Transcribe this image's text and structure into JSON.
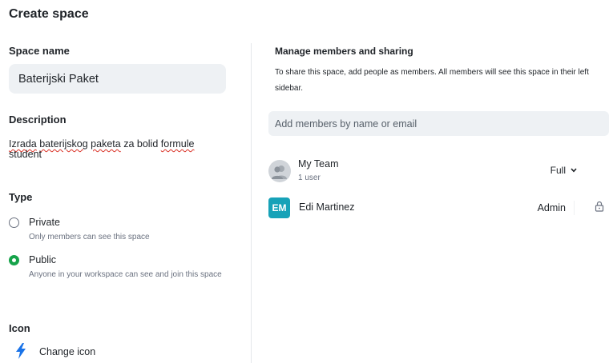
{
  "dialog": {
    "title": "Create space"
  },
  "space_name": {
    "label": "Space name",
    "value": "Baterijski Paket"
  },
  "description": {
    "label": "Description",
    "words": [
      "Izrada",
      "baterijskog",
      "paketa",
      "za",
      "bolid",
      "formule",
      "student"
    ]
  },
  "type": {
    "label": "Type",
    "options": [
      {
        "label": "Private",
        "sub": "Only members can see this space",
        "selected": false
      },
      {
        "label": "Public",
        "sub": "Anyone in your workspace can see and join this space",
        "selected": true
      }
    ]
  },
  "icon": {
    "label": "Icon",
    "change_label": "Change icon",
    "icon_name": "lightning-bolt-icon",
    "color": "#1a73e8"
  },
  "members": {
    "title": "Manage members and sharing",
    "description": "To share this space, add people as members. All members will see this space in their left sidebar.",
    "placeholder": "Add members by name or email",
    "team": {
      "name": "My Team",
      "sub": "1 user",
      "permission": "Full"
    },
    "user": {
      "initials": "EM",
      "name": "Edi Martinez",
      "role": "Admin",
      "avatar_color": "#17a2b8"
    }
  }
}
